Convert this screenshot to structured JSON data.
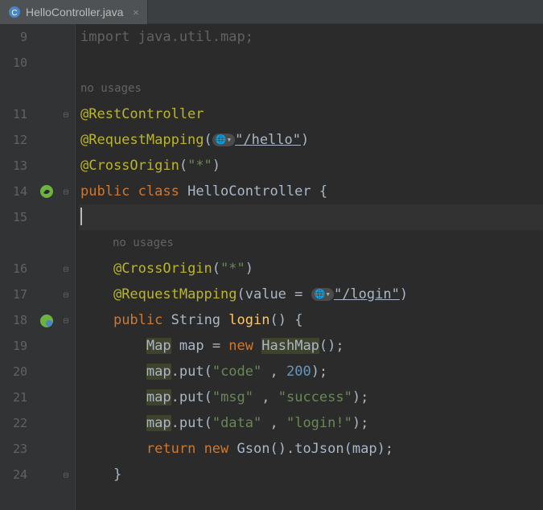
{
  "tab": {
    "filename": "HelloController.java"
  },
  "hints": {
    "noUsages1": "no usages",
    "noUsages2": "no usages"
  },
  "faded": {
    "import": "import java.util.map;"
  },
  "annotations": {
    "rest": "@RestController",
    "reqMapRoot": "@RequestMapping",
    "crossOriginRoot": "@CrossOrigin",
    "crossOriginMethod": "@CrossOrigin",
    "reqMapMethod": "@RequestMapping"
  },
  "strings": {
    "hello": "\"/hello\"",
    "star1": "\"*\"",
    "star2": "\"*\"",
    "login": "\"/login\"",
    "code": "\"code\"",
    "msg": "\"msg\"",
    "success": "\"success\"",
    "data": "\"data\"",
    "loginVal": "\"login!\""
  },
  "numbers": {
    "twoHundred": "200"
  },
  "keywords": {
    "public1": "public",
    "class": "class",
    "public2": "public",
    "new1": "new",
    "new2": "new",
    "return": "return",
    "value": "value"
  },
  "ids": {
    "cls": "HelloController",
    "String": "String",
    "login": "login",
    "Map": "Map",
    "mapVar": "map",
    "HashMap": "HashMap",
    "put": "put",
    "Gson": "Gson",
    "toJson": "toJson"
  },
  "lineNums": {
    "l9": "9",
    "l10": "10",
    "l11": "11",
    "l12": "12",
    "l13": "13",
    "l14": "14",
    "l15": "15",
    "l16": "16",
    "l17": "17",
    "l18": "18",
    "l19": "19",
    "l20": "20",
    "l21": "21",
    "l22": "22",
    "l23": "23",
    "l24": "24"
  }
}
